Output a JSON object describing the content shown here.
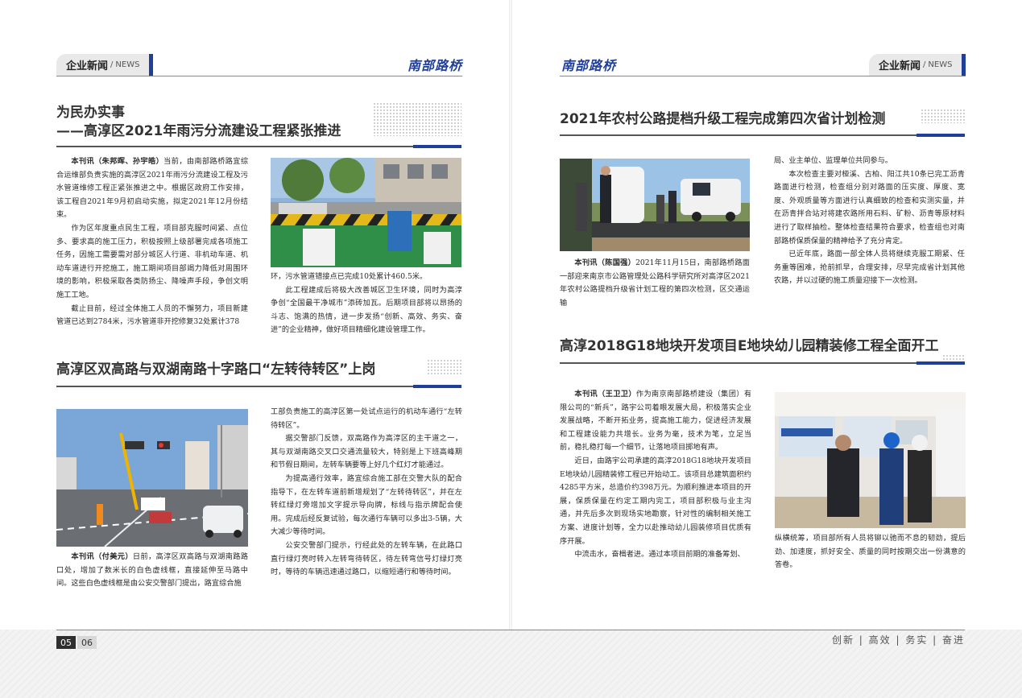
{
  "colors": {
    "accent": "#1f3f9a",
    "tab_bg": "#e9e9ea"
  },
  "header": {
    "left_tab": {
      "label": "企业新闻",
      "sep": "/",
      "sub": "NEWS"
    },
    "right_tab": {
      "label": "企业新闻",
      "sep": "/",
      "sub": "NEWS"
    },
    "logo_left": "南部路桥",
    "logo_right": "南部路桥"
  },
  "left": {
    "article1": {
      "title_line1": "为民办实事",
      "title_line2": "——高淳区2021年雨污分流建设工程紧张推进",
      "col1": {
        "byline": "本刊讯（朱邦晖、孙宇皓）",
        "p1": "当前，由南部路桥路宜综合运维部负责实施的高淳区2021年雨污分流建设工程及污水管道维修工程正紧张推进之中。根据区政府工作安排，该工程自2021年9月初启动实施，拟定2021年12月份结束。",
        "p2": "作为区年度重点民生工程，项目部克服时间紧、点位多、要求高的施工压力，积极按照上级部署完成各项施工任务，因施工需要需对部分城区人行道、非机动车道、机动车道进行开挖施工，施工期间项目部竭力降低对周围环境的影响，积极采取各类防扬尘、降噪声手段，争创文明施工工地。",
        "p3": "截止目前，经过全体施工人员的不懈努力，项目新建管道已达到2784米，污水管道非开挖修复32处累计378"
      },
      "col2": {
        "p1": "环，污水管道错接点已完成10处累计460.5米。",
        "p2": "此工程建成后将极大改善城区卫生环境，同时为高淳争创“全国最干净城市”添砖加瓦。后期项目部将以昂扬的斗志、饱满的热情，进一步发扬“创新、高效、务实、奋进”的企业精神，做好项目精细化建设管理工作。"
      }
    },
    "article2": {
      "title": "高淳区双高路与双湖南路十字路口“左转待转区”上岗",
      "col1": {
        "byline": "本刊讯（付美元）",
        "p1": "日前，高淳区双高路与双湖南路路口处，增加了数米长的白色虚线框，直接延伸至马路中间。这些白色虚线框是由公安交警部门提出，路宜综合施"
      },
      "col2": {
        "p1": "工部负责施工的高淳区第一处试点运行的机动车通行“左转待转区”。",
        "p2": "据交警部门反馈，双高路作为高淳区的主干道之一，其与双湖南路交叉口交通流量较大，特别是上下班高峰期和节假日期间，左转车辆要等上好几个红灯才能通过。",
        "p3": "为提高通行效率，路宜综合施工部在交警大队的配合指导下，在左转车道前新增规划了“左转待转区”，并在左转红绿灯旁增加文字提示导向牌，标线与指示牌配合使用。完成后经反复试验，每次通行车辆可以多出3-5辆，大大减少等待时间。",
        "p4": "公安交警部门提示，行经此处的左转车辆，在此路口直行绿灯亮时转入左转弯待转区，待左转弯信号灯绿灯亮时，等待的车辆迅速通过路口，以缩短通行和等待时间。"
      }
    }
  },
  "right": {
    "article3": {
      "title": "2021年农村公路提档升级工程完成第四次省计划检测",
      "col1": {
        "byline": "本刊讯（陈国强）",
        "p1": "2021年11月15日，南部路桥路面一部迎来南京市公路管理处公路科学研究所对高淳区2021年农村公路提档升级省计划工程的第四次检测，区交通运输"
      },
      "col2": {
        "p1": "局、业主单位、监理单位共同参与。",
        "p2": "本次检查主要对桠溪、古柏、阳江共10条已完工沥青路面进行检测，检查组分别对路面的压实度、厚度、宽度、外观质量等方面进行认真细致的检查和实测实量，并在沥青拌合站对将建农路所用石料、矿粉、沥青等原材料进行了取样抽检。整体检查结果符合要求，检查组也对南部路桥保质保量的精神给予了充分肯定。",
        "p3": "已近年底，路面一部全体人员将继续克服工期紧、任务重等困难，抢前抓早，合理安排，尽早完成省计划其他农路，并以过硬的施工质量迎接下一次检测。"
      }
    },
    "article4": {
      "title": "高淳2018G18地块开发项目E地块幼儿园精装修工程全面开工",
      "col1": {
        "byline": "本刊讯（王卫卫）",
        "p1": "作为南京南部路桥建设（集团）有限公司的“新兵”，路宇公司着眼发展大局，积极落实企业发展战略，不断开拓业务，提高施工能力，促进经济发展和工程建设能力共增长。业务为毫，技术为笔，立足当前，稳扎稳打每一个细节，让落地项目掷地有声。",
        "p2": "近日，由路宇公司承建的高淳2018G18地块开发项目E地块幼儿园精装修工程已开始动工。该项目总建筑面积约4285平方米，总造价约398万元。为顺利推进本项目的开展，保质保量在约定工期内完工，项目部积极与业主沟通，并先后多次到现场实地勘察，针对性的编制相关施工方案、进度计划等，全力以赴推动幼儿园装修项目优质有序开展。",
        "p3": "中流击水，奋楫者进。通过本项目前期的准备筹划、"
      },
      "col2": {
        "p1": "纵横统筹，项目部所有人员将铆以驰而不息的韧劲，提后劲、加速度，抓好安全、质量的同时按期交出一份满意的答卷。"
      }
    }
  },
  "footer": {
    "page_left": "05",
    "page_right": "06",
    "slogan": "创新 | 高效 | 务实 | 奋进"
  }
}
